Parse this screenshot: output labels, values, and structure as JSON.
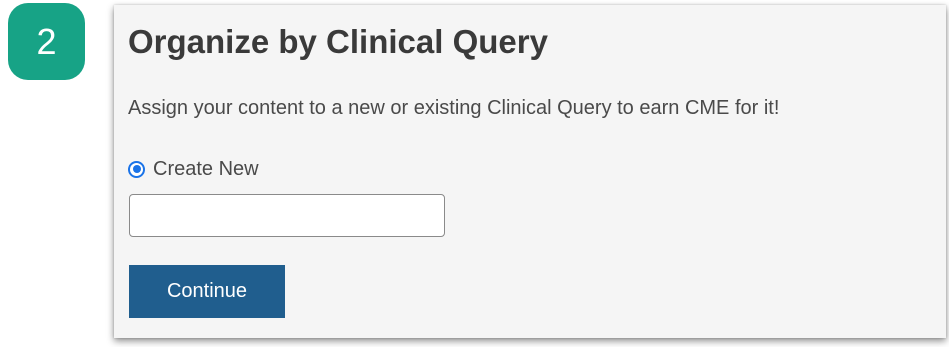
{
  "step": {
    "number": "2"
  },
  "section": {
    "title": "Organize by Clinical Query",
    "description": "Assign your content to a new or existing Clinical Query to earn CME for it!"
  },
  "form": {
    "create_new": {
      "label": "Create New",
      "selected": true
    },
    "query_input": {
      "value": "",
      "placeholder": ""
    },
    "continue_label": "Continue"
  },
  "colors": {
    "badge": "#17a386",
    "button": "#205e8e",
    "radio": "#1a73e8",
    "card_background": "#f5f5f5"
  }
}
